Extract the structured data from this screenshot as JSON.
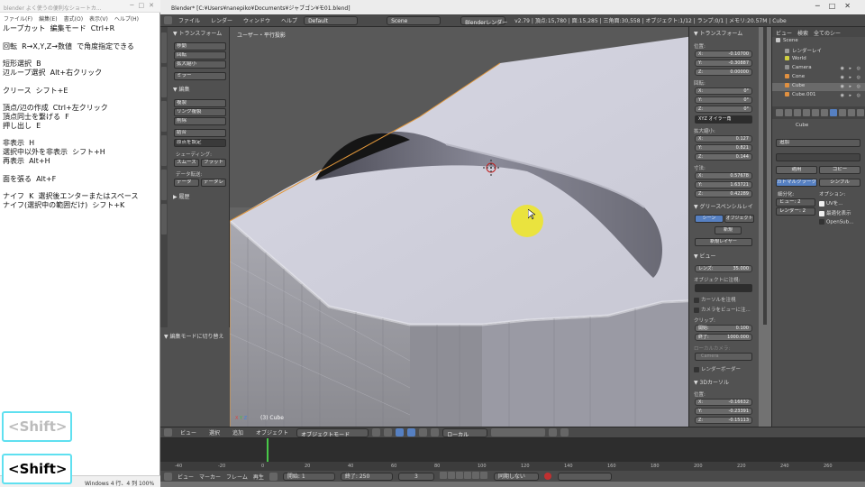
{
  "notepad": {
    "title": "blender よく使うの便利なショートカ...",
    "menu": [
      "ファイル(F)",
      "編集(E)",
      "書式(O)",
      "表示(V)",
      "ヘルプ(H)"
    ],
    "lines": [
      "ループカット  編集モード  Ctrl+R",
      "",
      "回転  R→X,Y,Z→数値  で角度指定できる",
      "",
      "短形選択  B",
      "辺ループ選択  Alt+右クリック",
      "",
      "クリース  シフト+E",
      "",
      "頂点/辺の作成  Ctrl+左クリック",
      "頂点同士を繋げる  F",
      "押し出し  E",
      "",
      "非表示  H",
      "選択中以外を非表示  シフト+H",
      "再表示  Alt+H",
      "",
      "面を張る  Alt+F",
      "",
      "ナイフ  K  選択後エンターまたはスペース",
      "ナイフ(選択中の範囲だけ)  シフト+K"
    ],
    "status": "Windows    4 行、4 列  100%"
  },
  "keys": {
    "ghost": "<Shift>",
    "active": "<Shift>"
  },
  "blender": {
    "title": "Blender* [C:¥Users¥nanepiko¥Documents¥ジャブゴン¥モ01.blend]",
    "menu": [
      "ファイル",
      "レンダー",
      "ウィンドウ",
      "ヘルプ"
    ],
    "layout": "Default",
    "scene": "Scene",
    "engine": "Blenderレンダー",
    "stats": "v2.79 | 頂点:15,780 | 面:15,285 | 三角面:30,558 | オブジェクト:1/12 | ランプ:0/1 | メモリ:20.57M | Cube"
  },
  "tools": {
    "transform_header": "▼ トランスフォーム",
    "transform_buttons": [
      "移動",
      "回転",
      "拡大縮小",
      "ミラー"
    ],
    "edit_header": "▼ 編集",
    "edit_buttons": [
      "複製",
      "リンク複製",
      "削除",
      "結合",
      "原点を設定"
    ],
    "shading_label": "シェーディング:",
    "smooth": "スムーズ",
    "flat": "フラット",
    "data_label": "データ転送:",
    "data1": "データ",
    "data2": "データレ",
    "history_header": "▶ 履歴",
    "footer": "▼ 編集モードに切り替え"
  },
  "viewport": {
    "label": "ユーザー・平行投影",
    "object": "(3) Cube",
    "x_axis": "X",
    "y_axis": "Y",
    "z_axis": "Z"
  },
  "props": {
    "transform": "▼ トランスフォーム",
    "location": "位置:",
    "loc": [
      {
        "a": "X:",
        "v": "-0.10700"
      },
      {
        "a": "Y:",
        "v": "-0.30887"
      },
      {
        "a": "Z:",
        "v": "0.00000"
      }
    ],
    "rotation": "回転:",
    "rot": [
      {
        "a": "X:",
        "v": "0°"
      },
      {
        "a": "Y:",
        "v": "0°"
      },
      {
        "a": "Z:",
        "v": "0°"
      }
    ],
    "rot_mode": "XYZ オイラー角",
    "scale": "拡大縮小:",
    "scl": [
      {
        "a": "X:",
        "v": "0.127"
      },
      {
        "a": "Y:",
        "v": "0.821"
      },
      {
        "a": "Z:",
        "v": "0.144"
      }
    ],
    "dimensions": "寸法:",
    "dim": [
      {
        "a": "X:",
        "v": "0.57678"
      },
      {
        "a": "Y:",
        "v": "1.63721"
      },
      {
        "a": "Z:",
        "v": "0.42289"
      }
    ],
    "grease": "▼ グリースペンシルレイ",
    "scene_btn": "シーン",
    "object_btn": "オブジェクト",
    "new_btn": "新規",
    "new_layer": "新規レイヤー",
    "view_header": "▼ ビュー",
    "lens": "レンズ:",
    "lens_val": "35.000",
    "lock_to": "オブジェクトに注視:",
    "lock_cursor": "カーソルを注視",
    "lock_camera": "カメラをビューに注...",
    "clip": "クリップ:",
    "clip_start": "開始:",
    "clip_start_val": "0.100",
    "clip_end": "終了:",
    "clip_end_val": "1000.000",
    "local_cam": "ローカルカメラ:",
    "camera": "Camera",
    "render_border": "レンダーボーダー",
    "cursor3d": "▼ 3Dカーソル",
    "cursor_loc": "位置:",
    "cur": [
      {
        "a": "X:",
        "v": "-0.16632"
      },
      {
        "a": "Y:",
        "v": "-0.23391"
      },
      {
        "a": "Z:",
        "v": "-0.15113"
      }
    ]
  },
  "outliner": {
    "view": "ビュー",
    "search": "検索",
    "all": "全てのシー",
    "rows": [
      {
        "name": "Scene",
        "color": "#c8c8c8"
      },
      {
        "name": "レンダーレイ",
        "color": "#9a9a9a"
      },
      {
        "name": "World",
        "color": "#d0d040"
      },
      {
        "name": "Camera",
        "color": "#909090"
      },
      {
        "name": "Cone",
        "color": "#e09040"
      },
      {
        "name": "Cube",
        "color": "#e09040"
      },
      {
        "name": "Cube.001",
        "color": "#e09040"
      }
    ]
  },
  "rprops": {
    "object_name": "Cube",
    "modifier": "追加",
    "apply": "適用",
    "copy": "コピー",
    "catmull": "カトマルクラーク",
    "simple": "シンプル",
    "subdiv": "細分化:",
    "view_lbl": "ビュー:",
    "view_val": "2",
    "render_lbl": "レンダー:",
    "render_val": "2",
    "options": "オプション:",
    "uv": "UVを...",
    "opt_cage": "最適化表示",
    "opensubdiv": "OpenSub..."
  },
  "header": {
    "menu": [
      "ビュー",
      "選択",
      "追加",
      "オブジェクト"
    ],
    "mode": "オブジェクトモード",
    "orientation": "ローカル"
  },
  "timeline": {
    "ticks": [
      "-40",
      "-20",
      "0",
      "20",
      "40",
      "60",
      "80",
      "100",
      "120",
      "140",
      "160",
      "180",
      "200",
      "220",
      "240",
      "260"
    ],
    "menu": [
      "ビュー",
      "マーカー",
      "フレーム",
      "再生"
    ],
    "start_lbl": "開始:",
    "start": "1",
    "end_lbl": "終了:",
    "end": "250",
    "current": "3",
    "sync": "同期しない"
  },
  "colors": {
    "highlight": "#5680c2",
    "cursor_circle": "#eee628",
    "key_border": "#5fe0f0"
  }
}
